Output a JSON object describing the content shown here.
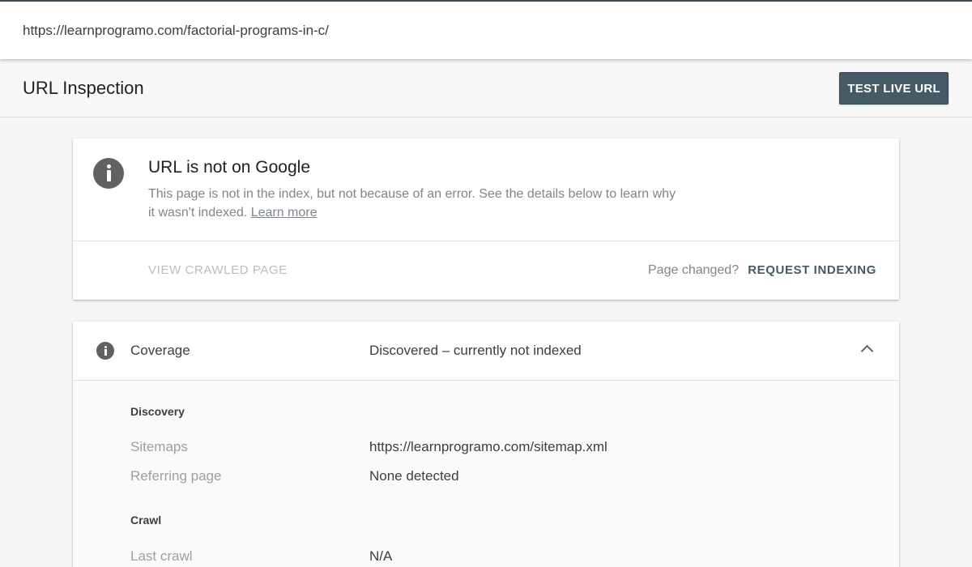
{
  "address_bar": {
    "url": "https://learnprogramo.com/factorial-programs-in-c/"
  },
  "header": {
    "title": "URL Inspection",
    "test_live_url_label": "TEST LIVE URL"
  },
  "status_card": {
    "icon": "info-icon",
    "title": "URL is not on Google",
    "description": "This page is not in the index, but not because of an error. See the details below to learn why it wasn't indexed.",
    "learn_more_label": "Learn more",
    "view_crawled_label": "VIEW CRAWLED PAGE",
    "page_changed_label": "Page changed?",
    "request_indexing_label": "REQUEST INDEXING"
  },
  "coverage": {
    "icon": "info-icon",
    "label": "Coverage",
    "value": "Discovered – currently not indexed",
    "expanded": true,
    "sections": {
      "discovery": {
        "title": "Discovery",
        "sitemaps_label": "Sitemaps",
        "sitemaps_value": "https://learnprogramo.com/sitemap.xml",
        "referring_label": "Referring page",
        "referring_value": "None detected"
      },
      "crawl": {
        "title": "Crawl",
        "last_crawl_label": "Last crawl",
        "last_crawl_value": "N/A"
      }
    }
  },
  "colors": {
    "primary_button": "#455a64",
    "icon_gray": "#616161",
    "muted_text": "#80868b",
    "disabled_text": "#bdbdbd"
  }
}
